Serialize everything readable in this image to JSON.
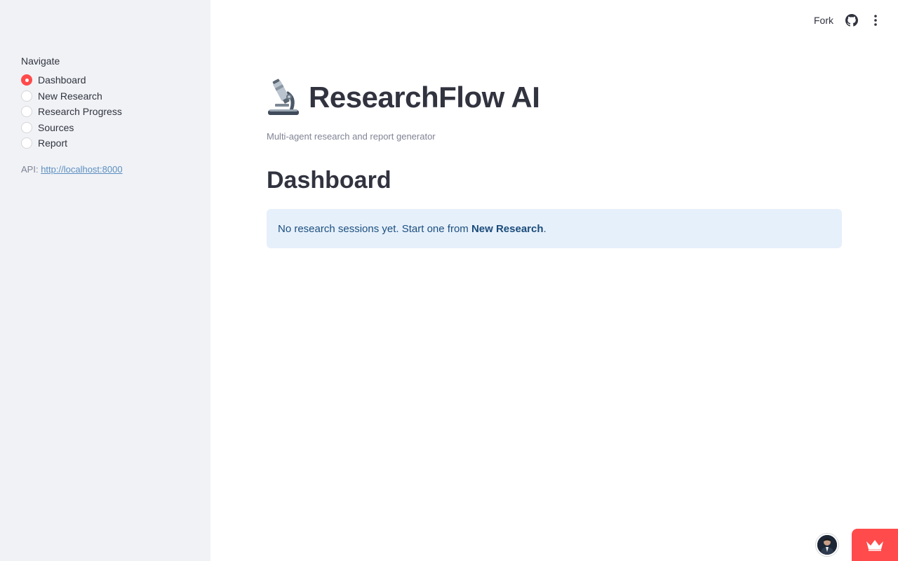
{
  "sidebar": {
    "nav_title": "Navigate",
    "items": [
      {
        "label": "Dashboard",
        "selected": true
      },
      {
        "label": "New Research",
        "selected": false
      },
      {
        "label": "Research Progress",
        "selected": false
      },
      {
        "label": "Sources",
        "selected": false
      },
      {
        "label": "Report",
        "selected": false
      }
    ],
    "api_label": "API:",
    "api_url": "http://localhost:8000"
  },
  "topbar": {
    "fork_label": "Fork",
    "github_icon": "github-icon",
    "menu_icon": "more-vertical-icon"
  },
  "main": {
    "title_icon": "microscope-icon",
    "title": "ResearchFlow AI",
    "subtitle": "Multi-agent research and report generator",
    "section_title": "Dashboard",
    "info": {
      "text_before": "No research sessions yet. Start one from ",
      "link_text": "New Research",
      "text_after": "."
    }
  },
  "footer": {
    "avatar_icon": "user-avatar",
    "badge_icon": "crown-icon"
  },
  "colors": {
    "accent": "#ff4b4b",
    "sidebar_bg": "#f0f2f6",
    "info_bg": "#e6f0fb",
    "info_text": "#1c4f7f"
  }
}
